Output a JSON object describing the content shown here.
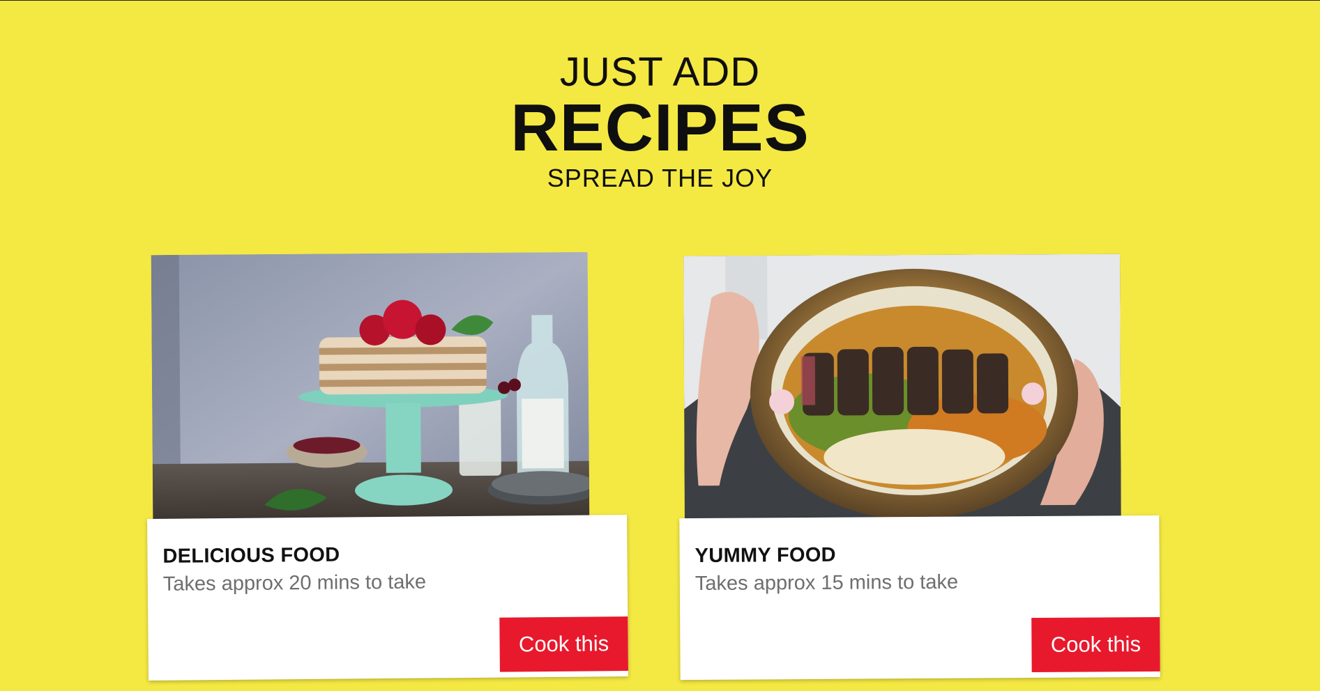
{
  "hero": {
    "line1": "JUST ADD",
    "line2": "RECIPES",
    "line3": "SPREAD THE JOY"
  },
  "cards": [
    {
      "title": "DELICIOUS FOOD",
      "description": "Takes approx 20 mins to take",
      "button_label": "Cook this",
      "image_icon": "cake-photo"
    },
    {
      "title": "YUMMY FOOD",
      "description": "Takes approx 15 mins to take",
      "button_label": "Cook this",
      "image_icon": "salad-bowl-photo"
    }
  ],
  "colors": {
    "background": "#f4e843",
    "button": "#e8192c",
    "card": "#ffffff"
  }
}
